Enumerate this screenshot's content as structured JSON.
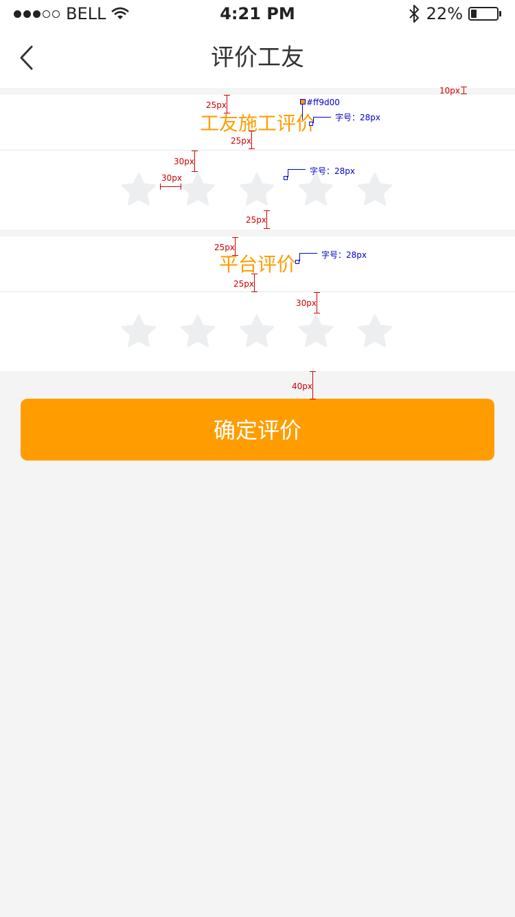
{
  "status_bar": {
    "carrier": "BELL",
    "time": "4:21 PM",
    "battery": "22%",
    "battery_level": 0.22
  },
  "nav": {
    "title": "评价工友",
    "back_icon": "chevron-left-icon"
  },
  "worker_section": {
    "title": "工友施工评价",
    "star_count": 5
  },
  "platform_section": {
    "title": "平台评价",
    "star_count": 5
  },
  "confirm_button": {
    "label": "确定评价"
  },
  "annotations": {
    "gap_10": "10px",
    "gap_25": "25px",
    "gap_30": "30px",
    "gap_40": "40px",
    "color_code": "#ff9d00",
    "font_size": "字号：28px"
  },
  "colors": {
    "accent": "#ff9d00",
    "star_inactive": "#eceef0",
    "page_bg": "#f4f4f4",
    "annotation_red": "#cc0000",
    "annotation_blue": "#0000cc"
  }
}
